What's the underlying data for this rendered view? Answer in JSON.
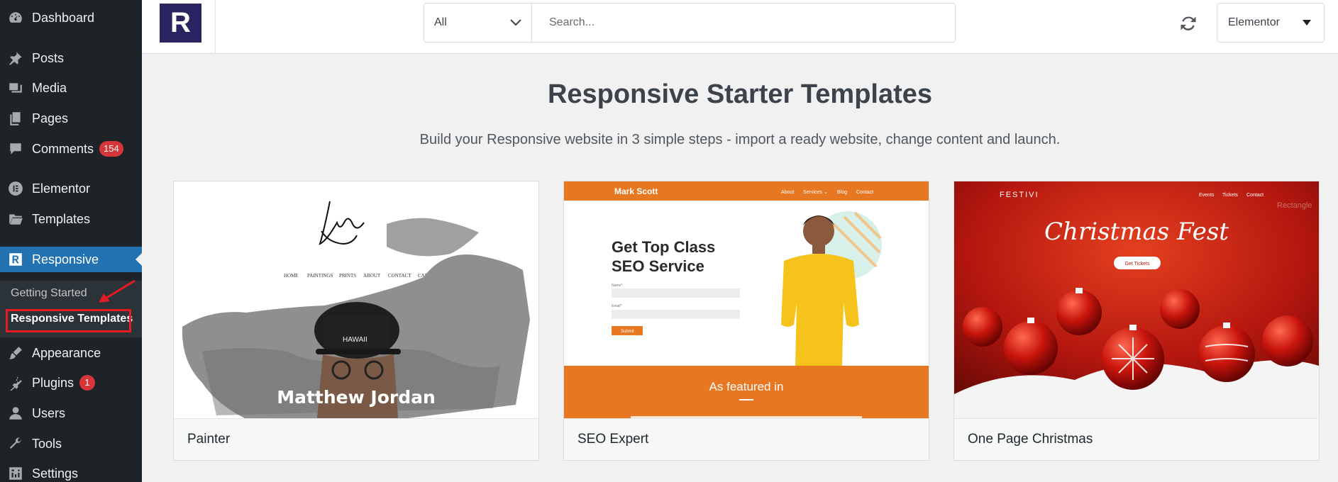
{
  "sidebar": {
    "items": [
      {
        "label": "Dashboard",
        "icon": "dashboard-icon"
      },
      {
        "label": "Posts",
        "icon": "pin-icon"
      },
      {
        "label": "Media",
        "icon": "media-icon"
      },
      {
        "label": "Pages",
        "icon": "pages-icon"
      },
      {
        "label": "Comments",
        "icon": "comment-icon",
        "badge": "154"
      },
      {
        "label": "Elementor",
        "icon": "elementor-icon"
      },
      {
        "label": "Templates",
        "icon": "folder-icon"
      },
      {
        "label": "Responsive",
        "icon": "responsive-icon"
      },
      {
        "label": "Appearance",
        "icon": "brush-icon"
      },
      {
        "label": "Plugins",
        "icon": "plug-icon",
        "badge": "1"
      },
      {
        "label": "Users",
        "icon": "user-icon"
      },
      {
        "label": "Tools",
        "icon": "wrench-icon"
      },
      {
        "label": "Settings",
        "icon": "settings-icon"
      }
    ],
    "submenu": [
      {
        "label": "Getting Started"
      },
      {
        "label": "Responsive Templates"
      }
    ]
  },
  "header": {
    "logo_letter": "R",
    "filter_value": "All",
    "search_placeholder": "Search...",
    "builder_value": "Elementor"
  },
  "main": {
    "title": "Responsive Starter Templates",
    "subtitle": "Build your Responsive website in 3 simple steps - import a ready website, change content and launch."
  },
  "cards": [
    {
      "name": "Painter",
      "thumb": {
        "signature": "Matthew Jordan",
        "nav": [
          "HOME",
          "PAINTINGS",
          "PRINTS",
          "ABOUT",
          "CONTACT",
          "CART"
        ],
        "hero_name": "Matthew Jordan",
        "cap_text": "HAWAII"
      }
    },
    {
      "name": "SEO Expert",
      "thumb": {
        "brand": "Mark Scott",
        "nav": [
          "About",
          "Services ⌄",
          "Blog",
          "Contact"
        ],
        "headline_1": "Get Top Class",
        "headline_2": "SEO Service",
        "field_1": "Name*",
        "field_2": "Email*",
        "submit": "Submit",
        "featured": "As featured in"
      }
    },
    {
      "name": "One Page Christmas",
      "thumb": {
        "brand": "FESTIVI",
        "nav": [
          "Events",
          "Tickets",
          "Contact"
        ],
        "watermark": "Rectangle",
        "headline": "Christmas Fest",
        "cta": "Get Tickets"
      }
    }
  ],
  "colors": {
    "sidebar_bg": "#1d2327",
    "active_bg": "#2271b1",
    "badge": "#d63638",
    "highlight": "#e31b23",
    "logo_bg": "#2a2560",
    "seo_orange": "#e87722",
    "christmas_red": "#b5170f"
  }
}
